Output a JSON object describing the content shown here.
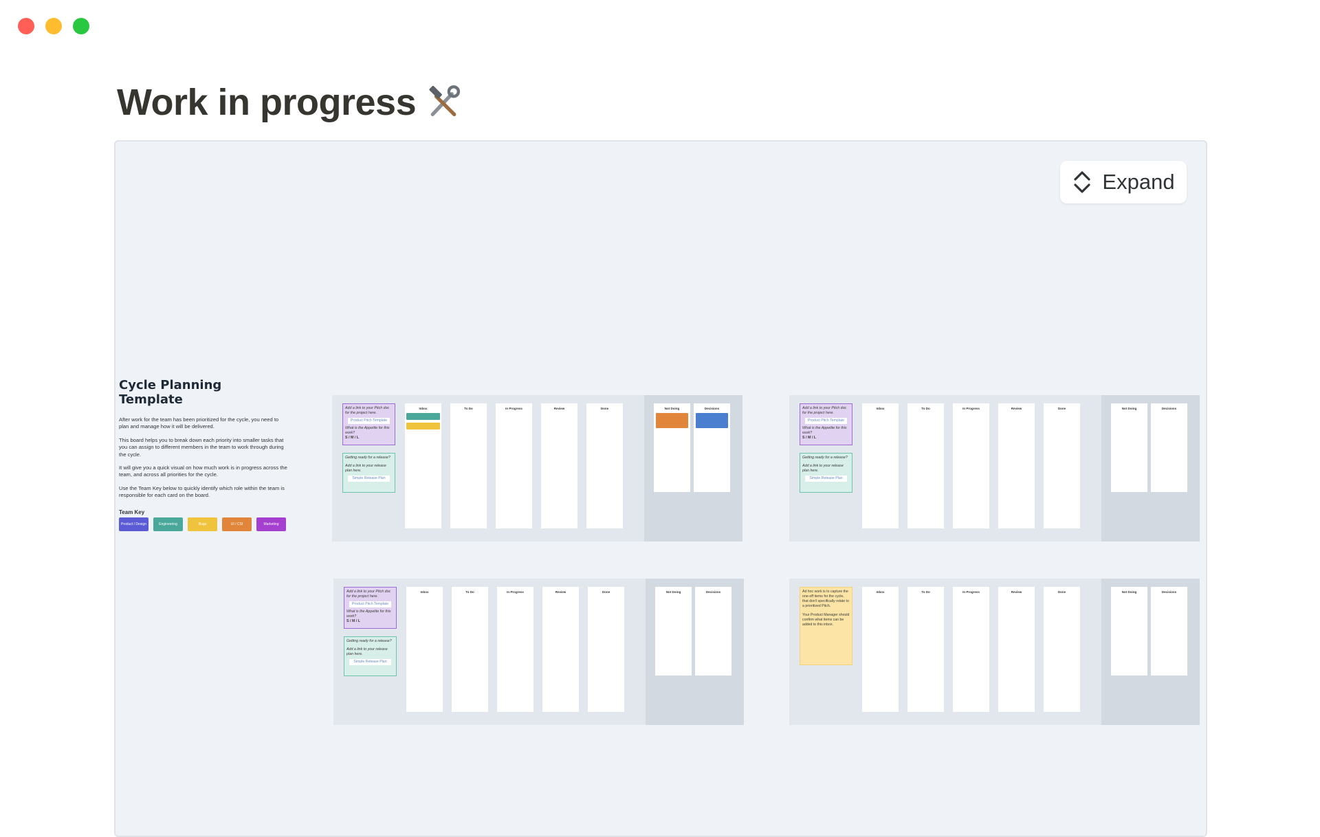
{
  "window": {
    "controls": [
      "close",
      "minimize",
      "maximize"
    ]
  },
  "page": {
    "title": "Work in progress",
    "title_icon": "hammer-and-wrench-icon"
  },
  "embed": {
    "expand_label": "Expand",
    "expand_icon": "expand-chevrons-icon",
    "intro": {
      "heading": "Cycle Planning Template",
      "paragraphs": [
        "After work for the team has been prioritized for the cycle, you need to plan and manage how it will be delivered.",
        "This board helps you to break down each priority into smaller tasks that you can assign to different members in the team to work through during the cycle.",
        "It will give you a quick visual on how much work is in progress across the team, and across all priorities for the cycle.",
        "Use the Team Key below to quickly identify which role within the team is responsible for each card on the board."
      ],
      "team_key_label": "Team Key",
      "team_key": [
        {
          "label": "Product / Design",
          "color": "#5b5bd6"
        },
        {
          "label": "Engineering",
          "color": "#4aa89a"
        },
        {
          "label": "Bugs",
          "color": "#f0c33c"
        },
        {
          "label": "UI / CSI",
          "color": "#e0853a"
        },
        {
          "label": "Marketing",
          "color": "#a43fcf"
        }
      ]
    },
    "board_columns": [
      "Inbox",
      "To Do",
      "In Progress",
      "Review",
      "Done"
    ],
    "side_columns": [
      "Not Doing",
      "Decisions"
    ],
    "notes": {
      "pitch_prompt": "Add a link to your Pitch doc for the project here.",
      "pitch_link": "Product Pitch Template",
      "appetite_prompt": "What is the Appetite for this work?",
      "appetite_sizes": "S / M / L",
      "release_prompt": "Getting ready for a release?",
      "release_link_prompt": "Add a link to your release plan here.",
      "release_link": "Simple Release Plan",
      "adhoc_text": "Ad hoc work is to capture the one-off items for the cycle, that don't specifically relate to a prioritized Pitch.",
      "adhoc_text2": "Your Product Manager should confirm what items can be added to this inbox."
    },
    "colors": {
      "canvas": "#eff2f6",
      "board": "#e2e6ed",
      "board_side": "#d3d9e1",
      "note_purple": "#e2d2f1",
      "note_teal": "#d8efe9",
      "note_yellow": "#fbe4a5",
      "card_teal": "#4aa89a",
      "card_yellow": "#f0c33c",
      "card_orange": "#e0853a",
      "card_blue": "#4a7fd0"
    }
  }
}
